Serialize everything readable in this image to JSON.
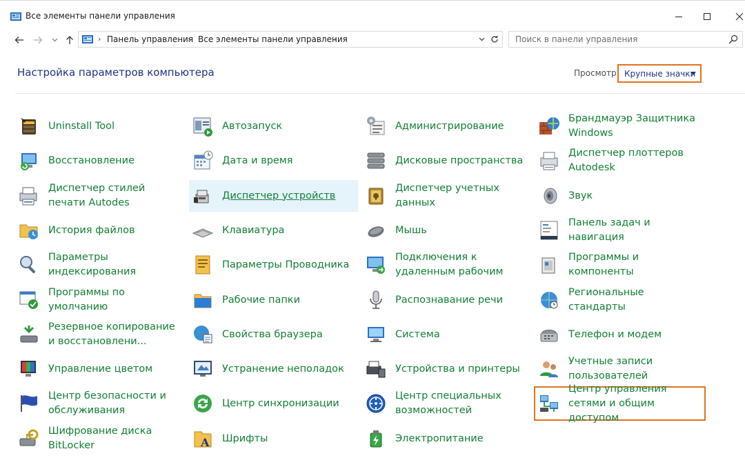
{
  "window": {
    "title": "Все элементы панели управления",
    "minimize": "minimize",
    "maximize": "maximize",
    "close": "close"
  },
  "address": {
    "crumbs": [
      "Панель управления",
      "Все элементы панели управления"
    ],
    "search_placeholder": "Поиск в панели управления"
  },
  "header": {
    "heading": "Настройка параметров компьютера",
    "view_label": "Просмотр:",
    "view_value": "Крупные значки"
  },
  "colors": {
    "accent": "#e07220",
    "link": "#118034",
    "heading": "#1e3287",
    "hover": "#e5f3fb"
  },
  "items": [
    {
      "label": "Uninstall Tool",
      "icon": "uninstall-tool-icon"
    },
    {
      "label": "Автозапуск",
      "icon": "autoplay-icon"
    },
    {
      "label": "Администрирование",
      "icon": "administration-icon"
    },
    {
      "label": "Брандмауэр Защитника Windows",
      "icon": "firewall-icon"
    },
    {
      "label": "Восстановление",
      "icon": "recovery-icon"
    },
    {
      "label": "Дата и время",
      "icon": "date-time-icon"
    },
    {
      "label": "Дисковые пространства",
      "icon": "storage-spaces-icon"
    },
    {
      "label": "Диспетчер плоттеров Autodesk",
      "icon": "plotter-manager-icon"
    },
    {
      "label": "Диспетчер стилей печати Autodes",
      "icon": "print-style-icon"
    },
    {
      "label": "Диспетчер устройств",
      "icon": "device-manager-icon"
    },
    {
      "label": "Диспетчер учетных данных",
      "icon": "credential-manager-icon"
    },
    {
      "label": "Звук",
      "icon": "sound-icon"
    },
    {
      "label": "История файлов",
      "icon": "file-history-icon"
    },
    {
      "label": "Клавиатура",
      "icon": "keyboard-icon"
    },
    {
      "label": "Мышь",
      "icon": "mouse-icon"
    },
    {
      "label": "Панель задач и навигация",
      "icon": "taskbar-icon"
    },
    {
      "label": "Параметры индексирования",
      "icon": "indexing-icon"
    },
    {
      "label": "Параметры Проводника",
      "icon": "explorer-options-icon"
    },
    {
      "label": "Подключения к удаленным рабочим",
      "icon": "remote-desktop-icon"
    },
    {
      "label": "Программы и компоненты",
      "icon": "programs-icon"
    },
    {
      "label": "Программы по умолчанию",
      "icon": "default-programs-icon"
    },
    {
      "label": "Рабочие папки",
      "icon": "work-folders-icon"
    },
    {
      "label": "Распознавание речи",
      "icon": "speech-icon"
    },
    {
      "label": "Региональные стандарты",
      "icon": "region-icon"
    },
    {
      "label": "Резервное копирование и восстановлени...",
      "icon": "backup-icon"
    },
    {
      "label": "Свойства браузера",
      "icon": "browser-properties-icon"
    },
    {
      "label": "Система",
      "icon": "system-icon"
    },
    {
      "label": "Телефон и модем",
      "icon": "phone-modem-icon"
    },
    {
      "label": "Управление цветом",
      "icon": "color-management-icon"
    },
    {
      "label": "Устранение неполадок",
      "icon": "troubleshooting-icon"
    },
    {
      "label": "Устройства и принтеры",
      "icon": "devices-printers-icon"
    },
    {
      "label": "Учетные записи пользователей",
      "icon": "user-accounts-icon"
    },
    {
      "label": "Центр безопасности и обслуживания",
      "icon": "security-center-icon"
    },
    {
      "label": "Центр синхронизации",
      "icon": "sync-center-icon"
    },
    {
      "label": "Центр специальных возможностей",
      "icon": "ease-of-access-icon"
    },
    {
      "label": "Центр управления сетями и общим доступом",
      "icon": "network-center-icon"
    },
    {
      "label": "Шифрование диска BitLocker",
      "icon": "bitlocker-icon"
    },
    {
      "label": "Шрифты",
      "icon": "fonts-icon"
    },
    {
      "label": "Электропитание",
      "icon": "power-options-icon"
    }
  ]
}
